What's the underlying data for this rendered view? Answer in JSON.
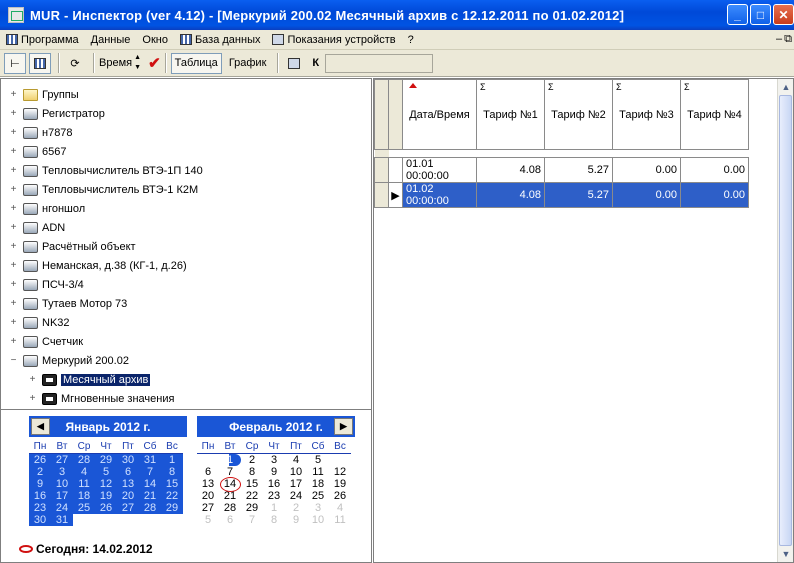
{
  "window": {
    "title": "MUR - Инспектор (ver 4.12) - [Меркурий 200.02 Месячный архив с 12.12.2011 по 01.02.2012]",
    "buttons": [
      "minimize-icon",
      "maximize-icon",
      "close-icon"
    ]
  },
  "menu": {
    "items": [
      "Программа",
      "Данные",
      "Окно",
      "База данных",
      "Показания устройств",
      "?"
    ]
  },
  "toolbar": {
    "time_label": "Время",
    "table_label": "Таблица",
    "chart_label": "График",
    "k_label": "К"
  },
  "tree": {
    "items": [
      {
        "label": "Группы",
        "icon": "folder-icon",
        "expander": "+"
      },
      {
        "label": "Регистратор",
        "icon": "device-icon",
        "expander": "+"
      },
      {
        "label": "н7878",
        "icon": "device-icon",
        "expander": "+"
      },
      {
        "label": "6567",
        "icon": "device-icon",
        "expander": "+"
      },
      {
        "label": "Тепловычислитель ВТЭ-1П 140",
        "icon": "device-icon",
        "expander": "+"
      },
      {
        "label": "Тепловычислитель ВТЭ-1 К2М",
        "icon": "device-icon",
        "expander": "+"
      },
      {
        "label": "нгоншол",
        "icon": "device-icon",
        "expander": "+"
      },
      {
        "label": "ADN",
        "icon": "device-icon",
        "expander": "+"
      },
      {
        "label": "Расчётный объект",
        "icon": "device-icon",
        "expander": "+"
      },
      {
        "label": "Неманская, д.38 (КГ-1, д.26)",
        "icon": "device-icon",
        "expander": "+"
      },
      {
        "label": "ПСЧ-3/4",
        "icon": "device-icon",
        "expander": "+"
      },
      {
        "label": "Тутаев Мотор 73",
        "icon": "device-icon",
        "expander": "+"
      },
      {
        "label": "NK32",
        "icon": "device-icon",
        "expander": "+"
      },
      {
        "label": "Счетчик",
        "icon": "device-icon",
        "expander": "+"
      },
      {
        "label": "Меркурий 200.02",
        "icon": "device-icon",
        "expander": "−"
      },
      {
        "label": "Месячный архив",
        "icon": "archive-icon",
        "expander": "+",
        "child": true,
        "selected": true
      },
      {
        "label": "Мгновенные значения",
        "icon": "archive-icon",
        "expander": "+",
        "child": true
      }
    ]
  },
  "calendar": {
    "weekdays": [
      "Пн",
      "Вт",
      "Ср",
      "Чт",
      "Пт",
      "Сб",
      "Вс"
    ],
    "left": {
      "title": "Январь 2012 г.",
      "days": [
        [
          "26",
          "27",
          "28",
          "29",
          "30",
          "31",
          "1"
        ],
        [
          "2",
          "3",
          "4",
          "5",
          "6",
          "7",
          "8"
        ],
        [
          "9",
          "10",
          "11",
          "12",
          "13",
          "14",
          "15"
        ],
        [
          "16",
          "17",
          "18",
          "19",
          "20",
          "21",
          "22"
        ],
        [
          "23",
          "24",
          "25",
          "26",
          "27",
          "28",
          "29"
        ],
        [
          "30",
          "31",
          "",
          "",
          "",
          "",
          ""
        ]
      ]
    },
    "right": {
      "title": "Февраль 2012 г.",
      "days": [
        [
          "",
          "1",
          "2",
          "3",
          "4",
          "5",
          ""
        ],
        [
          "6",
          "7",
          "8",
          "9",
          "10",
          "11",
          "12"
        ],
        [
          "13",
          "14",
          "15",
          "16",
          "17",
          "18",
          "19"
        ],
        [
          "20",
          "21",
          "22",
          "23",
          "24",
          "25",
          "26"
        ],
        [
          "27",
          "28",
          "29",
          "1",
          "2",
          "3",
          "4"
        ],
        [
          "5",
          "6",
          "7",
          "8",
          "9",
          "10",
          "11"
        ]
      ]
    },
    "today_text": "Сегодня: 14.02.2012"
  },
  "grid": {
    "headers": [
      "Дата/Время",
      "Тариф №1",
      "Тариф №2",
      "Тариф №3",
      "Тариф №4"
    ],
    "sigma": "Σ",
    "rows": [
      [
        "01.01 00:00:00",
        "4.08",
        "5.27",
        "0.00",
        "0.00"
      ],
      [
        "01.02 00:00:00",
        "4.08",
        "5.27",
        "0.00",
        "0.00"
      ]
    ]
  },
  "colors": {
    "title_bar": "#0054e3",
    "selection": "#0a246a",
    "calendar_accent": "#1a56d6",
    "today_circle": "#d01010",
    "selected_row": "#2e5fc8"
  }
}
